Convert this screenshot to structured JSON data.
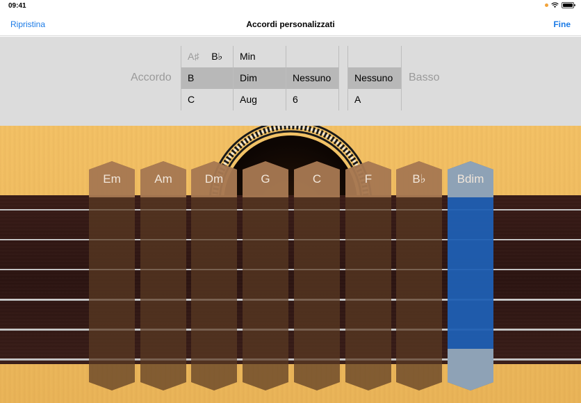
{
  "status_bar": {
    "time": "09:41"
  },
  "nav": {
    "reset_label": "Ripristina",
    "title": "Accordi personalizzati",
    "done_label": "Fine"
  },
  "picker": {
    "chord_label": "Accordo",
    "bass_label": "Basso",
    "root_column": {
      "above": "A♯",
      "above_alt": "B♭",
      "selected": "B",
      "below": "C"
    },
    "quality_column": {
      "above": "Min",
      "selected": "Dim",
      "below": "Aug"
    },
    "extension_column": {
      "above": "",
      "selected": "Nessuno",
      "below": "6"
    },
    "bass_column": {
      "above": "",
      "selected": "Nessuno",
      "below": "A"
    }
  },
  "chord_strips": [
    {
      "label": "Em",
      "selected": false
    },
    {
      "label": "Am",
      "selected": false
    },
    {
      "label": "Dm",
      "selected": false
    },
    {
      "label": "G",
      "selected": false
    },
    {
      "label": "C",
      "selected": false
    },
    {
      "label": "F",
      "selected": false
    },
    {
      "label": "B♭",
      "selected": false
    },
    {
      "label": "Bdim",
      "selected": true
    }
  ],
  "colors": {
    "accent": "#1a7ae6",
    "strip": "#5a3a22",
    "strip_selected": "#1f5fb3"
  }
}
